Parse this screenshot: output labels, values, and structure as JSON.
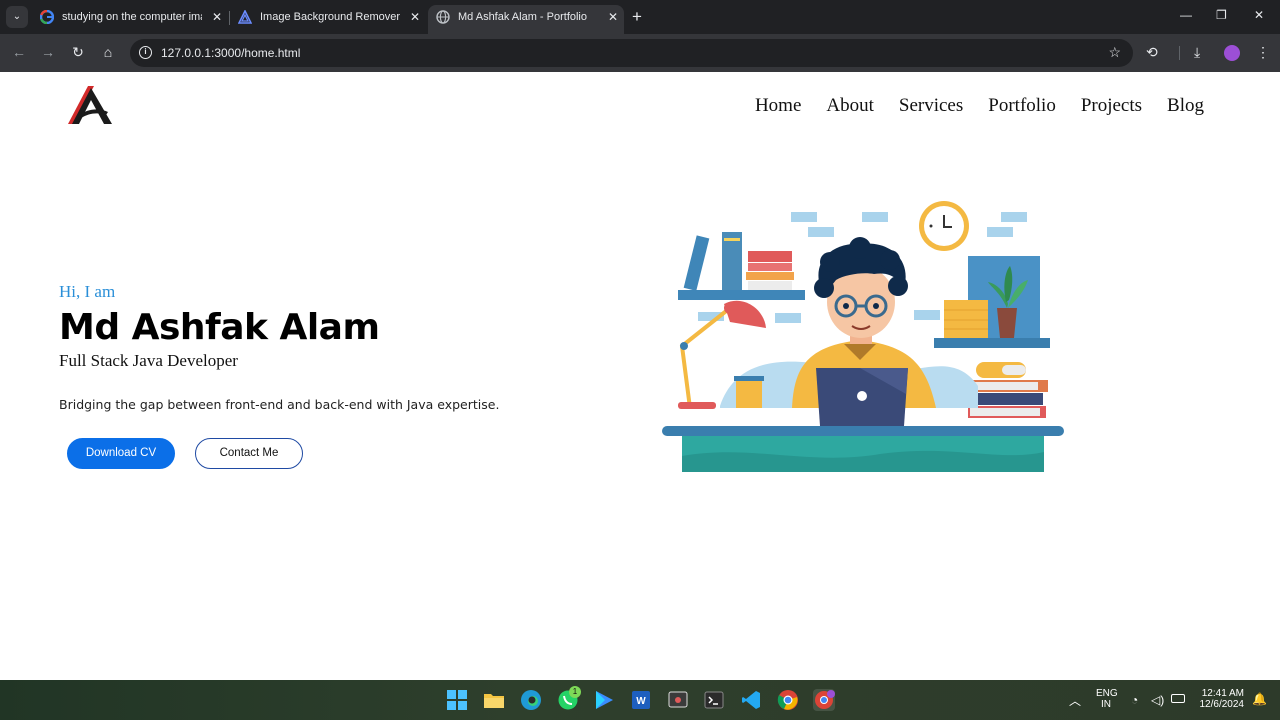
{
  "browser": {
    "tabs": [
      {
        "label": "studying on the computer imag",
        "icon": "google-icon",
        "active": false
      },
      {
        "label": "Image Background Remover | R",
        "icon": "app-logo-icon",
        "active": false
      },
      {
        "label": "Md Ashfak Alam - Portfolio",
        "icon": "globe-icon",
        "active": true
      }
    ],
    "url": "127.0.0.1:3000/home.html"
  },
  "site": {
    "nav": [
      "Home",
      "About",
      "Services",
      "Portfolio",
      "Projects",
      "Blog"
    ],
    "hero": {
      "greeting": "Hi, I am",
      "name": "Md Ashfak Alam",
      "role": "Full Stack Java Developer",
      "tagline": "Bridging the gap between front-end and back-end with Java expertise.",
      "primary_button": "Download CV",
      "secondary_button": "Contact Me"
    },
    "colors": {
      "accent": "#2a8fd8",
      "button": "#0b6fe8"
    }
  },
  "taskbar": {
    "apps": [
      "windows-start-icon",
      "file-explorer-icon",
      "edge-icon",
      "whatsapp-icon",
      "play-icon",
      "word-icon",
      "snipping-tool-icon",
      "terminal-icon",
      "vscode-icon",
      "chrome-icon",
      "chrome-profile-icon"
    ],
    "whatsapp_badge": "1",
    "lang_top": "ENG",
    "lang_bottom": "IN",
    "time": "12:41 AM",
    "date": "12/6/2024"
  }
}
